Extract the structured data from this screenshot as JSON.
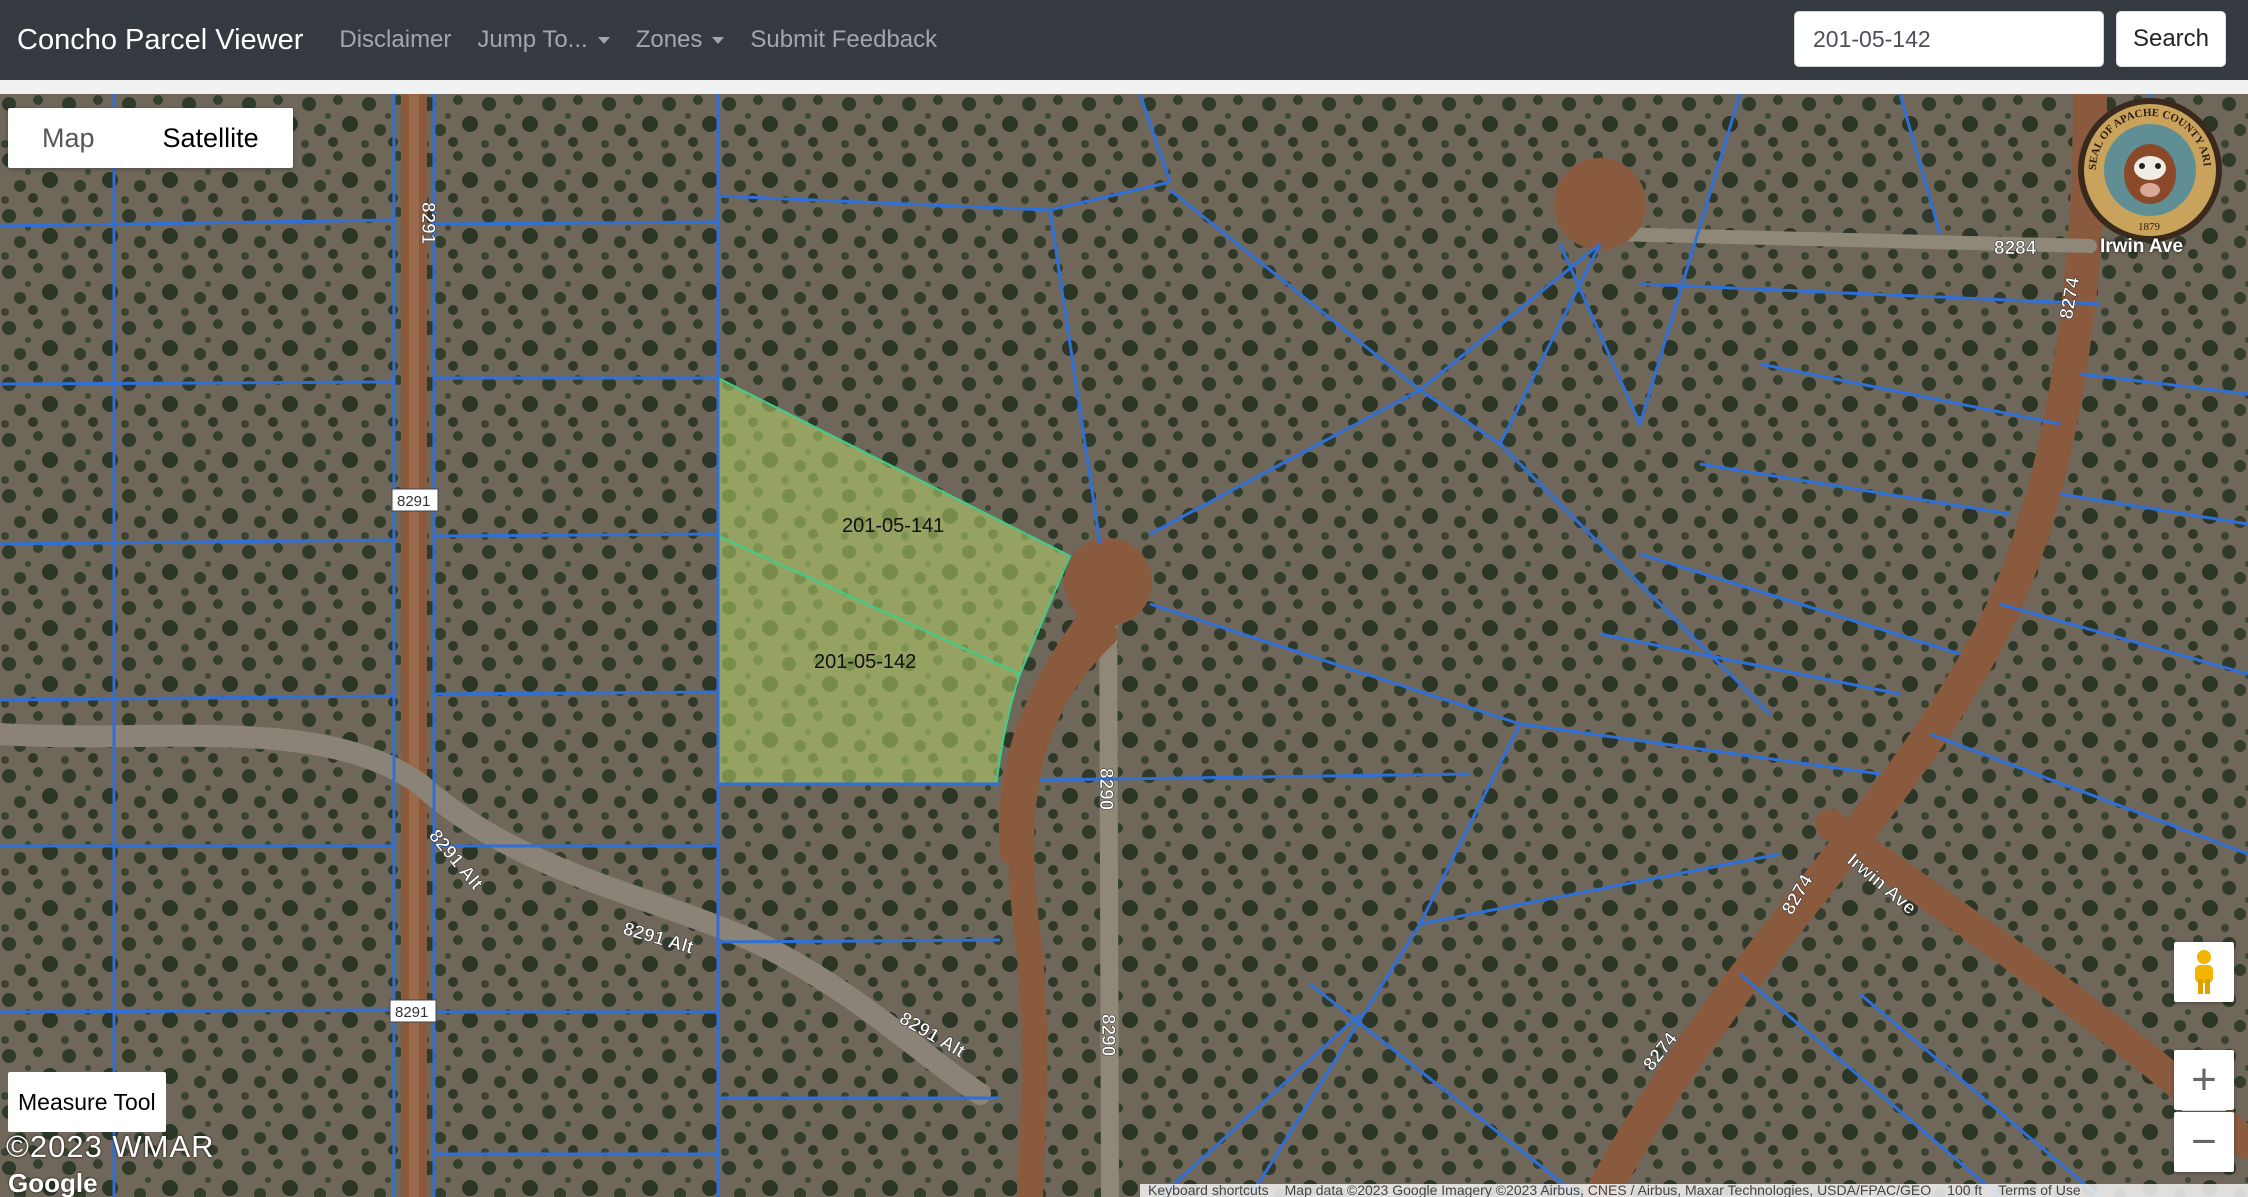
{
  "navbar": {
    "brand": "Concho Parcel Viewer",
    "links": [
      "Disclaimer",
      "Jump To...",
      "Zones",
      "Submit Feedback"
    ],
    "search_value": "201-05-142",
    "search_button": "Search"
  },
  "map": {
    "type_control": {
      "map": "Map",
      "satellite": "Satellite",
      "selected": "Satellite"
    },
    "parcels": {
      "a": "201-05-141",
      "b": "201-05-142"
    },
    "road_labels": {
      "r8291_top": "8291",
      "r8291_shield1": "8291",
      "r8291_shield2": "8291",
      "r8291alt_a": "8291 Alt",
      "r8291alt_b": "8291 Alt",
      "r8291alt_c": "8291 Alt",
      "r8290_a": "8290",
      "r8290_b": "8290",
      "r8284": "8284",
      "r8274_a": "8274",
      "r8274_b": "8274",
      "r8274_c": "8274",
      "irwin_a": "Irwin Ave",
      "irwin_b": "Irwin Ave"
    },
    "seal": {
      "top": "SEAL OF APACHE COUNTY ARIZONA",
      "year": "1879"
    },
    "measure_tool": "Measure Tool",
    "copyright": "©2023  WMAR",
    "google": "Google",
    "attribution": {
      "shortcuts": "Keyboard shortcuts",
      "mapdata": "Map data ©2023 Google Imagery ©2023 Airbus, CNES / Airbus, Maxar Technologies, USDA/FPAC/GEO",
      "scale": "100 ft",
      "terms": "Terms of Use"
    },
    "zoom_in": "+",
    "zoom_out": "−",
    "colors": {
      "parcel_line": "#2f6fd8",
      "selected_outline": "#3ccf8a",
      "selected_fill": "#b7d36a",
      "ground": "#6e6658",
      "dirt_road": "#8a5a3e"
    }
  }
}
